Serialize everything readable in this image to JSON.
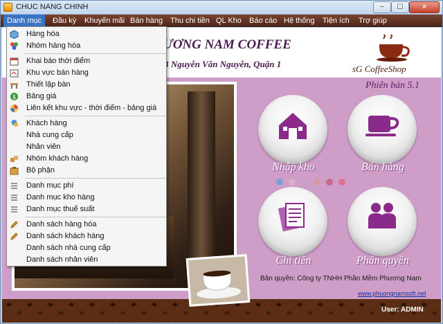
{
  "window": {
    "title": "CHUC NANG CHINH",
    "min_glyph": "−",
    "max_glyph": "☐",
    "close_glyph": "✕"
  },
  "menubar": {
    "items": [
      {
        "label": "Danh mục",
        "active": true
      },
      {
        "label": "Đầu kỳ"
      },
      {
        "label": "Khuyến mãi"
      },
      {
        "label": "Bán hàng"
      },
      {
        "label": "Thu chi tiền"
      },
      {
        "label": "QL Kho"
      },
      {
        "label": "Báo cáo"
      },
      {
        "label": "Hệ thống"
      },
      {
        "label": "Tiện ích"
      },
      {
        "label": "Trợ giúp"
      }
    ]
  },
  "dropdown": {
    "groups": [
      [
        {
          "label": "Hàng hóa",
          "icon": "box-icon"
        },
        {
          "label": "Nhóm hàng hóa",
          "icon": "group-items-icon"
        }
      ],
      [
        {
          "label": "Khai báo thời điểm",
          "icon": "calendar-icon"
        },
        {
          "label": "Khu vực bán hàng",
          "icon": "calendar-area-icon"
        },
        {
          "label": "Thiết lập bàn",
          "icon": "table-icon"
        },
        {
          "label": "Bảng giá",
          "icon": "money-icon"
        },
        {
          "label": "Liên kết khu vực - thời điểm - bảng giá",
          "icon": "link-icon"
        }
      ],
      [
        {
          "label": "Khách hàng",
          "icon": "customer-icon"
        },
        {
          "label": "Nhà cung cấp",
          "icon": ""
        },
        {
          "label": "Nhân viên",
          "icon": ""
        },
        {
          "label": "Nhóm khách hàng",
          "icon": "customer-group-icon"
        },
        {
          "label": "Bộ phận",
          "icon": "department-icon"
        }
      ],
      [
        {
          "label": "Danh mục phí",
          "icon": "list-icon"
        },
        {
          "label": "Danh mục kho hàng",
          "icon": "list-icon"
        },
        {
          "label": "Danh mục thuế suất",
          "icon": "list-icon"
        }
      ],
      [
        {
          "label": "Danh sách hàng hóa",
          "icon": "pencil-icon"
        },
        {
          "label": "Danh sách khách hàng",
          "icon": "pencil-icon"
        },
        {
          "label": "Danh sách nhà cung cấp",
          "icon": ""
        },
        {
          "label": "Danh sách nhân viên",
          "icon": ""
        }
      ]
    ]
  },
  "header": {
    "company_name": "ƯƠNG NAM COFFEE",
    "address": "B Nguyễn Văn Nguyễn, Quận 1",
    "logo_text": "sG CoffeeShop",
    "version": "Phiên bản 5.1"
  },
  "tiles": [
    {
      "label": "Nhập kho",
      "icon": "warehouse-icon"
    },
    {
      "label": "Bán hàng",
      "icon": "coffee-cup-icon"
    },
    {
      "label": "Chi tiền",
      "icon": "documents-icon"
    },
    {
      "label": "Phân quyền",
      "icon": "users-icon"
    }
  ],
  "footer": {
    "copyright": "Bản quyền: Công ty TNHH Phần Mềm Phương Nam",
    "website": "www.phuongnamsoft.net",
    "user": "User: ADMIN"
  },
  "colors": {
    "accent_purple": "#8a2a8a",
    "menubar_brown": "#5a2d14",
    "menu_active": "#3b73c4",
    "client_pink": "#cf9ec8"
  }
}
